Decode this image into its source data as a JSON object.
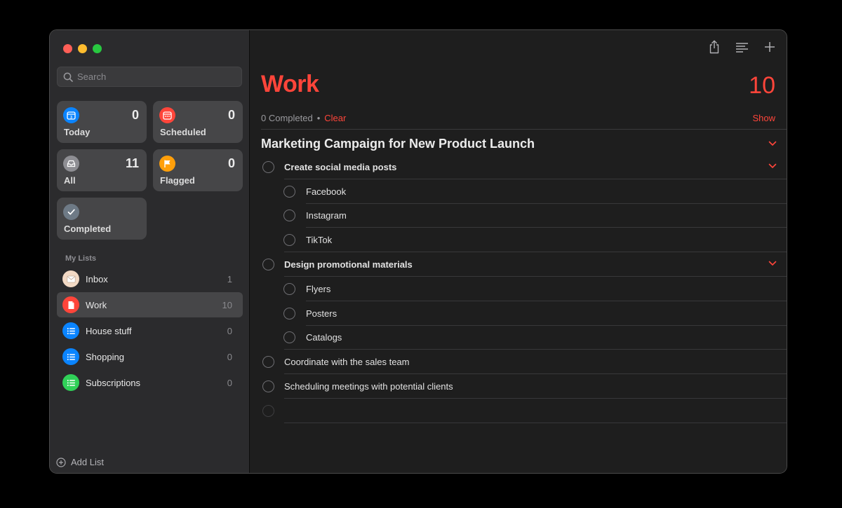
{
  "sidebar": {
    "search_placeholder": "Search",
    "smart_lists": [
      {
        "label": "Today",
        "count": "0",
        "color": "#0a84ff",
        "icon": "calendar-today-icon"
      },
      {
        "label": "Scheduled",
        "count": "0",
        "color": "#ff453a",
        "icon": "calendar-scheduled-icon"
      },
      {
        "label": "All",
        "count": "11",
        "color": "#8e8e93",
        "icon": "tray-icon"
      },
      {
        "label": "Flagged",
        "count": "0",
        "color": "#ff9f0a",
        "icon": "flag-icon"
      },
      {
        "label": "Completed",
        "count": "",
        "color": "#6e7a86",
        "icon": "checkmark-icon"
      }
    ],
    "my_lists_header": "My Lists",
    "lists": [
      {
        "label": "Inbox",
        "count": "1",
        "color": "#f2d9c4",
        "icon": "envelope-icon"
      },
      {
        "label": "Work",
        "count": "10",
        "color": "#ff453a",
        "icon": "document-icon"
      },
      {
        "label": "House stuff",
        "count": "0",
        "color": "#0a84ff",
        "icon": "list-icon"
      },
      {
        "label": "Shopping",
        "count": "0",
        "color": "#0a84ff",
        "icon": "list-icon"
      },
      {
        "label": "Subscriptions",
        "count": "0",
        "color": "#30d158",
        "icon": "list-icon"
      }
    ],
    "add_list_label": "Add List"
  },
  "main": {
    "title": "Work",
    "count": "10",
    "completed_text": "0 Completed",
    "separator": "•",
    "clear_label": "Clear",
    "show_label": "Show",
    "group_title": "Marketing Campaign for New Product Launch",
    "tasks": [
      {
        "name": "Create social media posts",
        "level": 0,
        "parent": true
      },
      {
        "name": "Facebook",
        "level": 1,
        "parent": false
      },
      {
        "name": "Instagram",
        "level": 1,
        "parent": false
      },
      {
        "name": "TikTok",
        "level": 1,
        "parent": false
      },
      {
        "name": "Design promotional materials",
        "level": 0,
        "parent": true
      },
      {
        "name": "Flyers",
        "level": 1,
        "parent": false
      },
      {
        "name": "Posters",
        "level": 1,
        "parent": false
      },
      {
        "name": "Catalogs",
        "level": 1,
        "parent": false
      },
      {
        "name": "Coordinate with the sales team",
        "level": 0,
        "parent": false
      },
      {
        "name": "Scheduling meetings with potential clients",
        "level": 0,
        "parent": false
      },
      {
        "name": "",
        "level": 0,
        "parent": false,
        "ghost": true
      }
    ]
  },
  "colors": {
    "accent": "#ff453a"
  }
}
